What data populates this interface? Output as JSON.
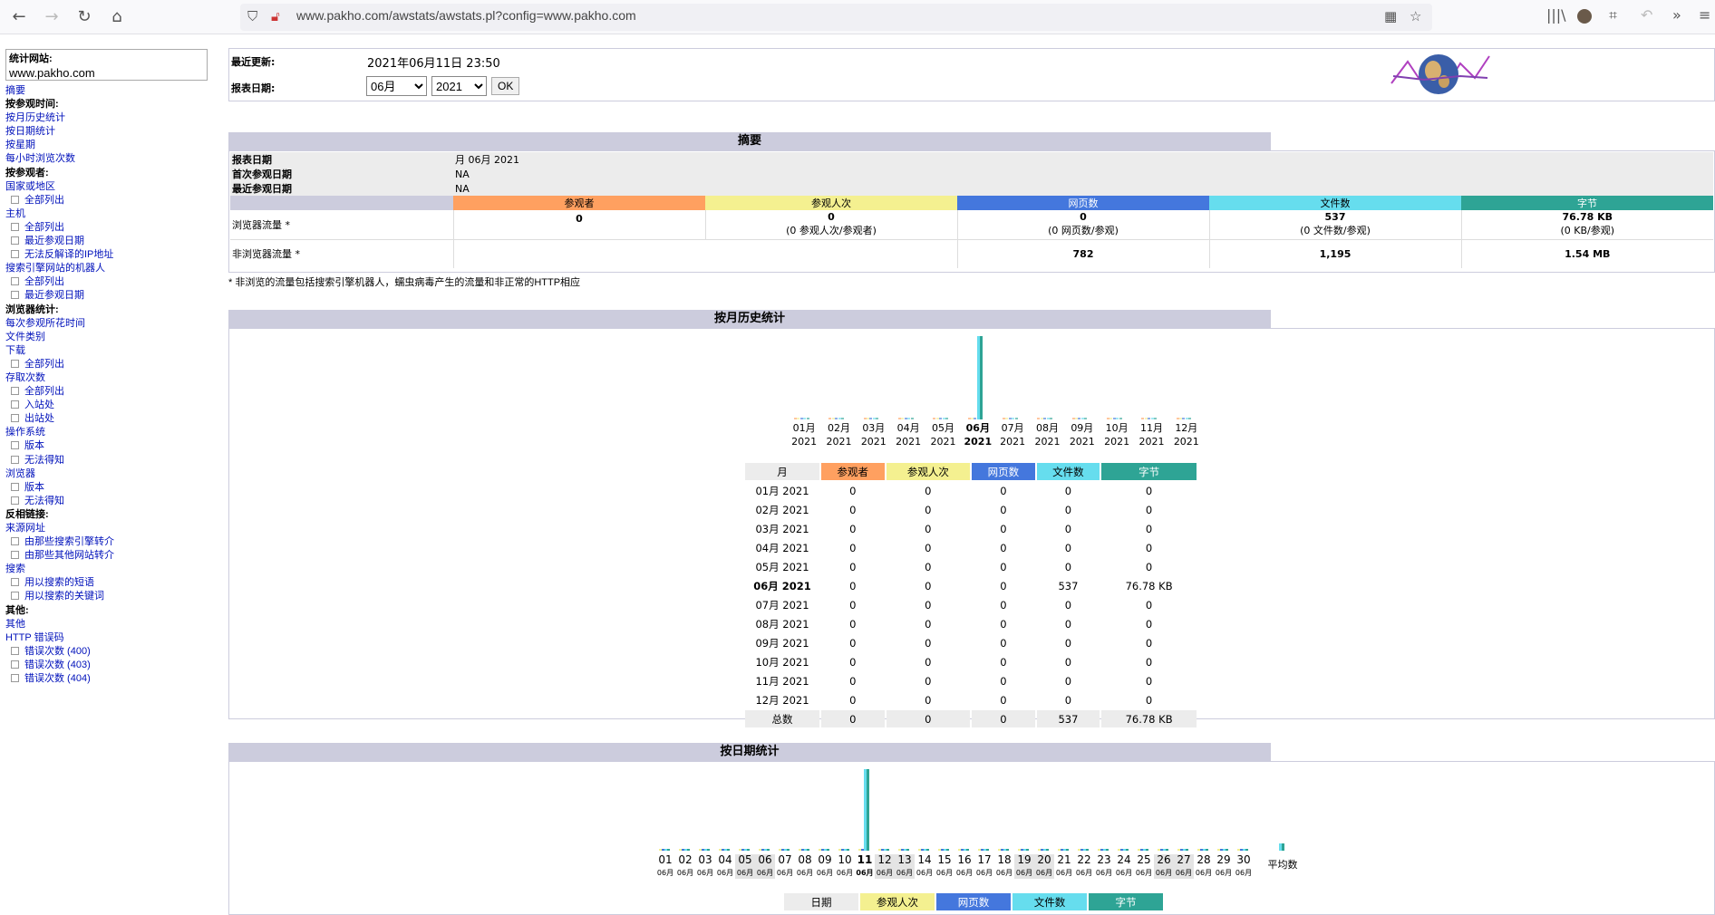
{
  "browser": {
    "url": "www.pakho.com/awstats/awstats.pl?config=www.pakho.com"
  },
  "sidebar": {
    "site_label": "统计网站:",
    "site_value": "www.pakho.com",
    "summary": "摘要",
    "by_time": "按参观时间:",
    "monthly": "按月历史统计",
    "daily": "按日期统计",
    "weekday": "按星期",
    "hourly": "每小时浏览次数",
    "by_visitor": "按参观者:",
    "country": "国家或地区",
    "country_all": "全部列出",
    "hosts": "主机",
    "hosts_all": "全部列出",
    "hosts_last": "最近参观日期",
    "hosts_unresolved": "无法反解译的IP地址",
    "robots": "搜索引擎网站的机器人",
    "robots_all": "全部列出",
    "robots_last": "最近参观日期",
    "nav_stats": "浏览器统计:",
    "visit_time": "每次参观所花时间",
    "filetypes": "文件类别",
    "downloads": "下载",
    "downloads_all": "全部列出",
    "pages": "存取次数",
    "pages_all": "全部列出",
    "entry": "入站处",
    "exit": "出站处",
    "os": "操作系统",
    "os_version": "版本",
    "os_unknown": "无法得知",
    "browsers": "浏览器",
    "browsers_version": "版本",
    "browsers_unknown": "无法得知",
    "referers_h": "反相链接:",
    "origin": "来源网址",
    "origin_se": "由那些搜索引擎转介",
    "origin_other": "由那些其他网站转介",
    "search": "搜索",
    "search_phrases": "用以搜索的短语",
    "search_keywords": "用以搜索的关键词",
    "others_h": "其他:",
    "misc": "其他",
    "errors": "HTTP 错误码",
    "err400": "错误次数 (400)",
    "err403": "错误次数 (403)",
    "err404": "错误次数 (404)"
  },
  "header": {
    "last_update_label": "最近更新:",
    "last_update_value": "2021年06月11日 23:50",
    "period_label": "报表日期:",
    "month_selected": "06月",
    "year_selected": "2021",
    "ok": "OK"
  },
  "summary": {
    "title": "摘要",
    "period_label": "报表日期",
    "period_value": "月 06月 2021",
    "first_label": "首次参观日期",
    "first_value": "NA",
    "last_label": "最近参观日期",
    "last_value": "NA",
    "col_visitors": "参观者",
    "col_visits": "参观人次",
    "col_pages": "网页数",
    "col_hits": "文件数",
    "col_bytes": "字节",
    "viewed_label": "浏览器流量 *",
    "viewed_visitors": "0",
    "viewed_visits": "0",
    "viewed_visits_sub": "(0 参观人次/参观者)",
    "viewed_pages": "0",
    "viewed_pages_sub": "(0 网页数/参观)",
    "viewed_hits": "537",
    "viewed_hits_sub": "(0 文件数/参观)",
    "viewed_bytes": "76.78 KB",
    "viewed_bytes_sub": "(0 KB/参观)",
    "notviewed_label": "非浏览器流量 *",
    "notviewed_pages": "782",
    "notviewed_hits": "1,195",
    "notviewed_bytes": "1.54 MB",
    "footnote": "* 非浏览的流量包括搜索引擎机器人，蠕虫病毒产生的流量和非正常的HTTP相应"
  },
  "monthly": {
    "title": "按月历史统计",
    "col_month": "月",
    "col_visitors": "参观者",
    "col_visits": "参观人次",
    "col_pages": "网页数",
    "col_hits": "文件数",
    "col_bytes": "字节",
    "axis": [
      {
        "m": "01月",
        "y": "2021"
      },
      {
        "m": "02月",
        "y": "2021"
      },
      {
        "m": "03月",
        "y": "2021"
      },
      {
        "m": "04月",
        "y": "2021"
      },
      {
        "m": "05月",
        "y": "2021"
      },
      {
        "m": "06月",
        "y": "2021"
      },
      {
        "m": "07月",
        "y": "2021"
      },
      {
        "m": "08月",
        "y": "2021"
      },
      {
        "m": "09月",
        "y": "2021"
      },
      {
        "m": "10月",
        "y": "2021"
      },
      {
        "m": "11月",
        "y": "2021"
      },
      {
        "m": "12月",
        "y": "2021"
      }
    ],
    "rows": [
      [
        "01月 2021",
        "0",
        "0",
        "0",
        "0",
        "0"
      ],
      [
        "02月 2021",
        "0",
        "0",
        "0",
        "0",
        "0"
      ],
      [
        "03月 2021",
        "0",
        "0",
        "0",
        "0",
        "0"
      ],
      [
        "04月 2021",
        "0",
        "0",
        "0",
        "0",
        "0"
      ],
      [
        "05月 2021",
        "0",
        "0",
        "0",
        "0",
        "0"
      ],
      [
        "06月 2021",
        "0",
        "0",
        "0",
        "537",
        "76.78 KB"
      ],
      [
        "07月 2021",
        "0",
        "0",
        "0",
        "0",
        "0"
      ],
      [
        "08月 2021",
        "0",
        "0",
        "0",
        "0",
        "0"
      ],
      [
        "09月 2021",
        "0",
        "0",
        "0",
        "0",
        "0"
      ],
      [
        "10月 2021",
        "0",
        "0",
        "0",
        "0",
        "0"
      ],
      [
        "11月 2021",
        "0",
        "0",
        "0",
        "0",
        "0"
      ],
      [
        "12月 2021",
        "0",
        "0",
        "0",
        "0",
        "0"
      ]
    ],
    "total": [
      "总数",
      "0",
      "0",
      "0",
      "537",
      "76.78 KB"
    ],
    "hits_by_month": [
      0,
      0,
      0,
      0,
      0,
      537,
      0,
      0,
      0,
      0,
      0,
      0
    ],
    "bytes_by_month": [
      0,
      0,
      0,
      0,
      0,
      76.78,
      0,
      0,
      0,
      0,
      0,
      0
    ]
  },
  "daily": {
    "title": "按日期统计",
    "days": [
      "01",
      "02",
      "03",
      "04",
      "05",
      "06",
      "07",
      "08",
      "09",
      "10",
      "11",
      "12",
      "13",
      "14",
      "15",
      "16",
      "17",
      "18",
      "19",
      "20",
      "21",
      "22",
      "23",
      "24",
      "25",
      "26",
      "27",
      "28",
      "29",
      "30"
    ],
    "month_tag": "06月",
    "avg_label": "平均数",
    "hits_by_day": [
      0,
      0,
      0,
      0,
      0,
      0,
      0,
      0,
      0,
      0,
      537,
      0,
      0,
      0,
      0,
      0,
      0,
      0,
      0,
      0,
      0,
      0,
      0,
      0,
      0,
      0,
      0,
      0,
      0,
      0
    ],
    "col_date": "日期",
    "col_visits": "参观人次",
    "col_pages": "网页数",
    "col_hits": "文件数",
    "col_bytes": "字节"
  },
  "colors": {
    "visitors": "#ffa060",
    "visits": "#f4f090",
    "pages": "#4477dd",
    "hits": "#66ddee",
    "bytes": "#2ea495",
    "section": "#ccccdd",
    "link": "#0011bb"
  }
}
